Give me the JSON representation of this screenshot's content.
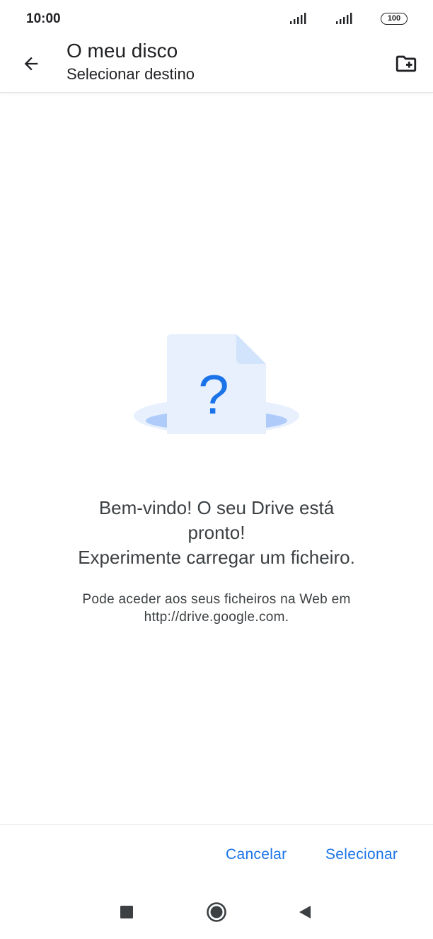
{
  "status_bar": {
    "time": "10:00",
    "battery": "100"
  },
  "app_bar": {
    "title": "O meu disco",
    "subtitle": "Selecionar destino",
    "icons": {
      "back": "arrow-back-icon",
      "new_folder": "new-folder-icon"
    }
  },
  "empty_state": {
    "illustration_icon": "unknown-file-icon",
    "illustration_glyph": "?",
    "welcome_lines": [
      "Bem-vindo! O seu Drive está",
      "pronto!",
      "Experimente carregar um ficheiro."
    ],
    "hint_lines": [
      "Pode aceder aos seus ficheiros na Web em",
      "http://drive.google.com."
    ]
  },
  "actions": {
    "cancel_label": "Cancelar",
    "select_label": "Selecionar"
  },
  "nav_bar": {
    "icons": [
      "recents-square-icon",
      "home-circle-icon",
      "back-triangle-icon"
    ]
  },
  "colors": {
    "accent": "#1a73e8",
    "illustration_page": "#e8f0fe",
    "illustration_hole": "#aecbfa"
  }
}
